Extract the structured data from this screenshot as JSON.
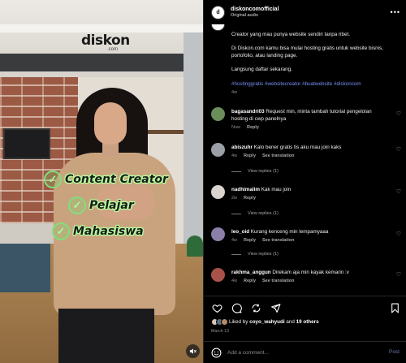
{
  "video": {
    "logo_text": "diskon",
    "logo_dot": ".",
    "logo_sub": "com",
    "overlay_lines": [
      "Content Creator",
      "Pelajar",
      "Mahasiswa"
    ],
    "check_glyph": "✓",
    "mute_icon": "speaker-muted-icon"
  },
  "post": {
    "username": "diskoncomofficial",
    "audio": "Original audio",
    "more_glyph": "•••",
    "caption_paragraphs": [
      "Creator yang mau punya website sendiri tanpa ribet.",
      "Di Diskon.com kamu bisa mulai hosting gratis untuk website bisnis, portofolio, atau landing page.",
      "Langsung daftar sekarang."
    ],
    "hashtags": "#hostinggratis #websitecreator #buatwebsite #diskoncom",
    "caption_age": "4w"
  },
  "comments": [
    {
      "user": "bagasandri03",
      "text": "Request min, minta tambah tutorial pengelolan hosting di cwp panelnya",
      "age": "Now",
      "reply": "Reply",
      "translate": "",
      "avatar_color": "#6b8f5a",
      "view_replies": ""
    },
    {
      "user": "abiszuhr",
      "text": "Kalo bener gratis tis aku mau join kaks",
      "age": "4w",
      "reply": "Reply",
      "translate": "See translation",
      "avatar_color": "#9aa0a6",
      "view_replies": "View replies (1)"
    },
    {
      "user": "nadhimalim",
      "text": "Kak mau join",
      "age": "2w",
      "reply": "Reply",
      "translate": "",
      "avatar_color": "#d9d4cf",
      "view_replies": "View replies (1)"
    },
    {
      "user": "leo_oid",
      "text": "Kurang kenceng min lempamyaaa",
      "age": "4w",
      "reply": "Reply",
      "translate": "See translation",
      "avatar_color": "#8a7fa8",
      "view_replies": "View replies (1)"
    },
    {
      "user": "rakhma_anggun",
      "text": "Direkam aja min kayak kemarin :v",
      "age": "4w",
      "reply": "Reply",
      "translate": "See translation",
      "avatar_color": "#a8524a",
      "view_replies": ""
    }
  ],
  "actions": {
    "icons": [
      "heart-icon",
      "comment-icon",
      "share-icon",
      "send-icon"
    ],
    "bookmark": "bookmark-icon",
    "liked_prefix": "Liked by ",
    "liked_user": "coyo_wahyudi",
    "liked_mid": " and ",
    "liked_others": "19 others",
    "date": "March 13"
  },
  "add_comment": {
    "placeholder": "Add a comment...",
    "post_label": "Post",
    "emoji_icon": "emoji-icon"
  },
  "colors": {
    "accent_link": "#7a8ff5",
    "overlay_green": "#b6ff9e",
    "background": "#000000"
  }
}
